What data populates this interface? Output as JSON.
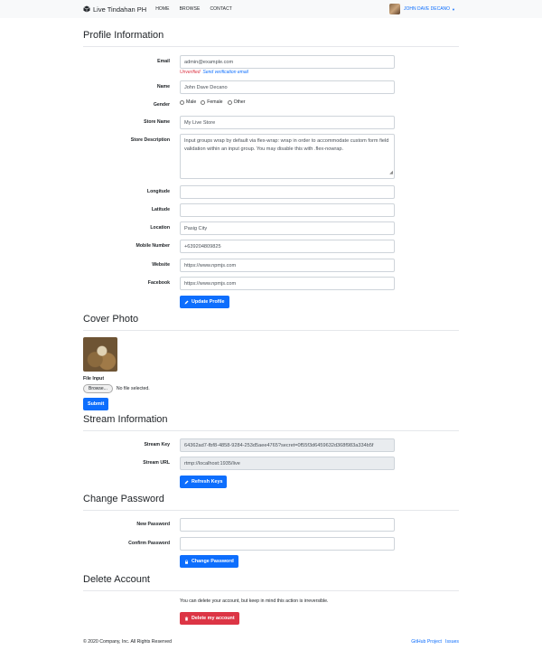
{
  "navbar": {
    "brand": "Live Tindahan PH",
    "links": [
      "HOME",
      "BROWSE",
      "CONTACT"
    ],
    "user": "JOHN DAVE DECANO"
  },
  "profile": {
    "heading": "Profile Information",
    "email_label": "Email",
    "email_value": "admin@example.com",
    "unverified": "Unverified",
    "send_verification": "Send verification email",
    "name_label": "Name",
    "name_value": "John Dave Decano",
    "gender_label": "Gender",
    "gender_options": [
      "Male",
      "Female",
      "Other"
    ],
    "store_name_label": "Store Name",
    "store_name_value": "My Live Store",
    "store_description_label": "Store Description",
    "store_description_value": "Input groups wrap by default via flex-wrap: wrap in order to accommodate custom form field validation within an input group. You may disable this with .flex-nowrap.",
    "longitude_label": "Longitude",
    "longitude_value": "",
    "latitude_label": "Latitude",
    "latitude_value": "",
    "location_label": "Location",
    "location_value": "Pasig City",
    "mobile_label": "Mobile Number",
    "mobile_value": "+639204809825",
    "website_label": "Website",
    "website_value": "https://www.npmjs.com",
    "facebook_label": "Facebook",
    "facebook_value": "https://www.npmjs.com",
    "update_button": "Update Profile"
  },
  "cover": {
    "heading": "Cover Photo",
    "file_input_label": "File Input",
    "browse_label": "Browse...",
    "no_file": "No file selected.",
    "submit_button": "Submit"
  },
  "stream": {
    "heading": "Stream Information",
    "key_label": "Stream Key",
    "key_value": "64362ad7-fbf8-4858-9284-253d5aee4765?secret=0f55f3d6459632d368f983a334b5f",
    "url_label": "Stream URL",
    "url_value": "rtmp://localhost:1935/live",
    "refresh_button": "Refresh Keys"
  },
  "password": {
    "heading": "Change Password",
    "new_label": "New Password",
    "new_value": "",
    "confirm_label": "Confirm Password",
    "confirm_value": "",
    "change_button": "Change Password"
  },
  "delete": {
    "heading": "Delete Account",
    "note": "You can delete your account, but keep in mind this action is irreversible.",
    "delete_button": "Delete my account"
  },
  "footer": {
    "copyright": "© 2020 Company, Inc. All Rights Reserved",
    "link_github": "GitHub Project",
    "link_issues": "Issues"
  },
  "colors": {
    "primary": "#0d6efd",
    "danger": "#dc3545",
    "navbar_bg": "#f8f9fa"
  }
}
